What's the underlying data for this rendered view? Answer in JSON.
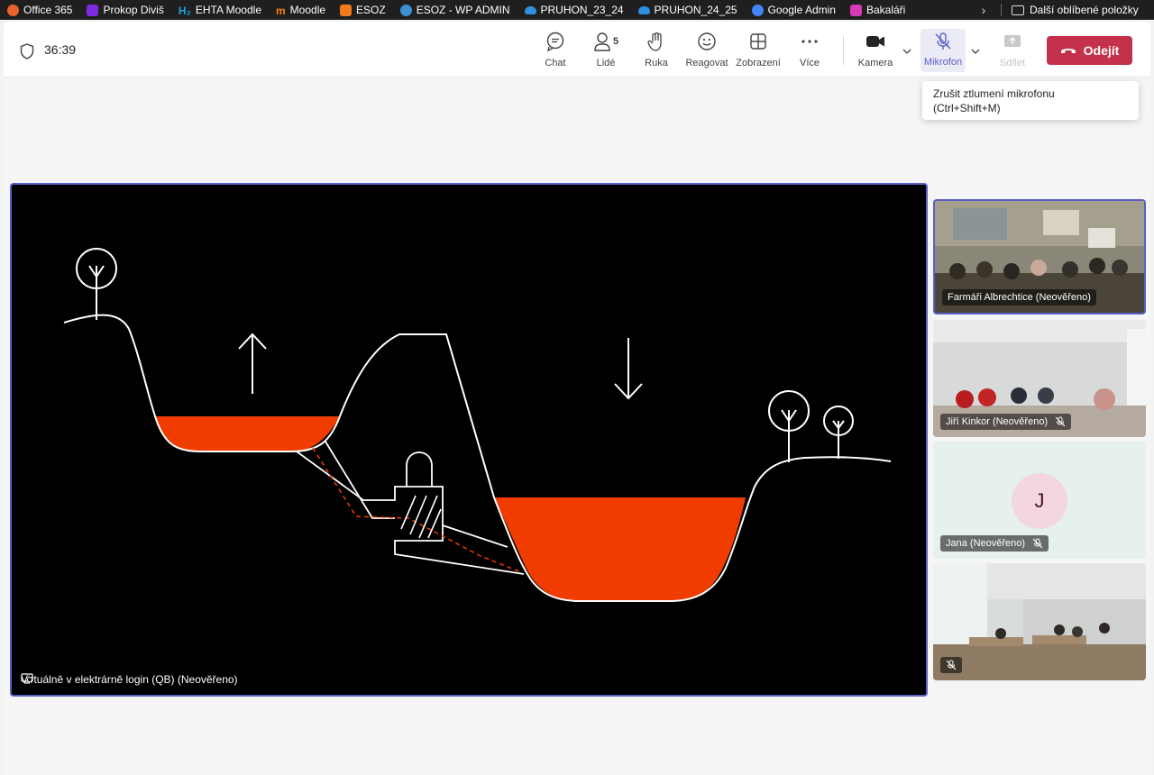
{
  "bookmarks": [
    {
      "label": "Office 365",
      "color": "#e8622c"
    },
    {
      "label": "Prokop Diviš",
      "color": "#7b2ae0"
    },
    {
      "label": "EHTA Moodle",
      "color": "#1ea2d8"
    },
    {
      "label": "Moodle",
      "color": "#f98012"
    },
    {
      "label": "ESOZ",
      "color": "#f27a1a"
    },
    {
      "label": "ESOZ - WP ADMIN",
      "color": "#3d8fd1"
    },
    {
      "label": "PRUHON_23_24",
      "color": "#2f8fe0"
    },
    {
      "label": "PRUHON_24_25",
      "color": "#2f8fe0"
    },
    {
      "label": "Google Admin",
      "color": "#4285f4"
    },
    {
      "label": "Bakaláři",
      "color": "#d63ab5"
    }
  ],
  "other_bookmarks": "Další oblíbené položky",
  "meeting": {
    "timer": "36:39",
    "toolbar": {
      "chat": "Chat",
      "people": "Lidé",
      "people_count": "5",
      "hand": "Ruka",
      "react": "Reagovat",
      "view": "Zobrazení",
      "more": "Více",
      "camera": "Kamera",
      "mic": "Mikrofon",
      "share": "Sdílet",
      "leave": "Odejít"
    },
    "tooltip_line1": "Zrušit ztlumení mikrofonu",
    "tooltip_line2": "(Ctrl+Shift+M)",
    "stage_label": "Virtuálně v elektrárně login (QB) (Neověřeno)",
    "participants": [
      {
        "name": "Farmáři Albrechtice (Neověřeno)",
        "muted": false
      },
      {
        "name": "Jiří Kinkor (Neověřeno)",
        "muted": true
      },
      {
        "name": "Jana (Neověřeno)",
        "muted": true,
        "initial": "J"
      },
      {
        "name": "",
        "muted": true
      }
    ]
  },
  "colors": {
    "accent": "#5b5fc7",
    "leave": "#c4314b",
    "water": "#f03c00"
  }
}
